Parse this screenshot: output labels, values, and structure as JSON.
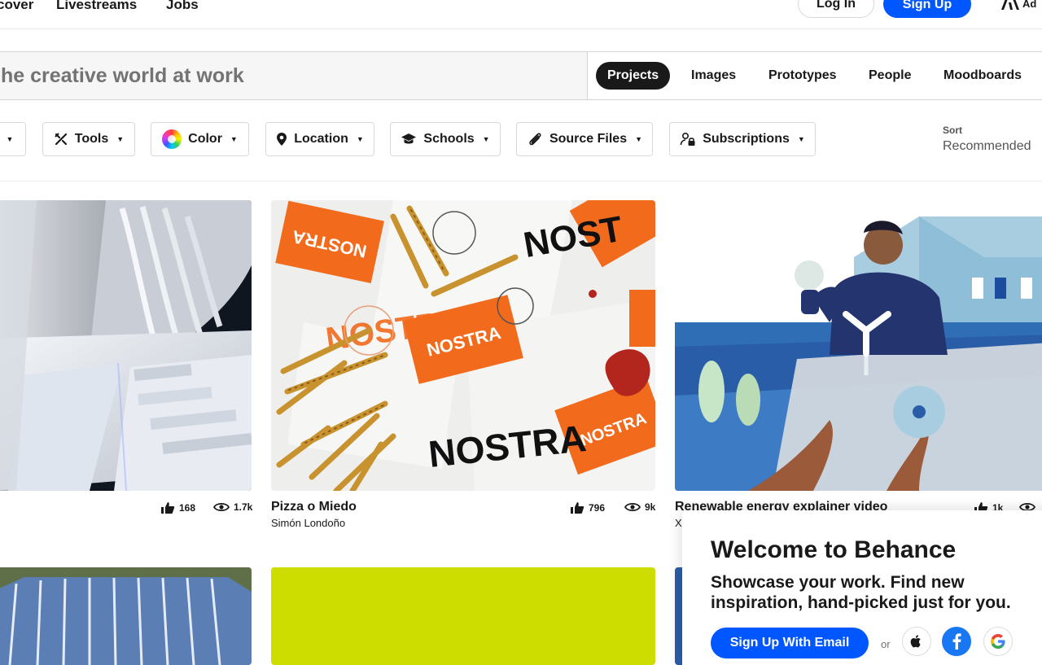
{
  "nav": {
    "links": [
      "cover",
      "Livestreams",
      "Jobs"
    ],
    "login": "Log In",
    "signup": "Sign Up",
    "adobe": "Ad"
  },
  "search": {
    "placeholder": "he creative world at work",
    "tabs": [
      "Projects",
      "Images",
      "Prototypes",
      "People",
      "Moodboards"
    ],
    "active_tab": "Projects"
  },
  "filters": {
    "items": [
      "Tools",
      "Color",
      "Location",
      "Schools",
      "Source Files",
      "Subscriptions"
    ],
    "sort_label": "Sort",
    "sort_value": "Recommended"
  },
  "projects": [
    {
      "title": "",
      "owner": "",
      "likes": "168",
      "views": "1.7k"
    },
    {
      "title": "Pizza o Miedo",
      "owner": "Simón Londoño",
      "likes": "796",
      "views": "9k"
    },
    {
      "title": "Renewable energy explainer video",
      "owner": "X",
      "likes": "1k",
      "views": ""
    }
  ],
  "welcome": {
    "title": "Welcome to Behance",
    "subtitle": "Showcase your work. Find new inspiration, hand-picked just for you.",
    "email_button": "Sign Up With Email",
    "or": "or"
  },
  "colors": {
    "brand_blue": "#0057ff",
    "nostra_orange": "#f26a1b",
    "lime_card": "#cddd00"
  }
}
